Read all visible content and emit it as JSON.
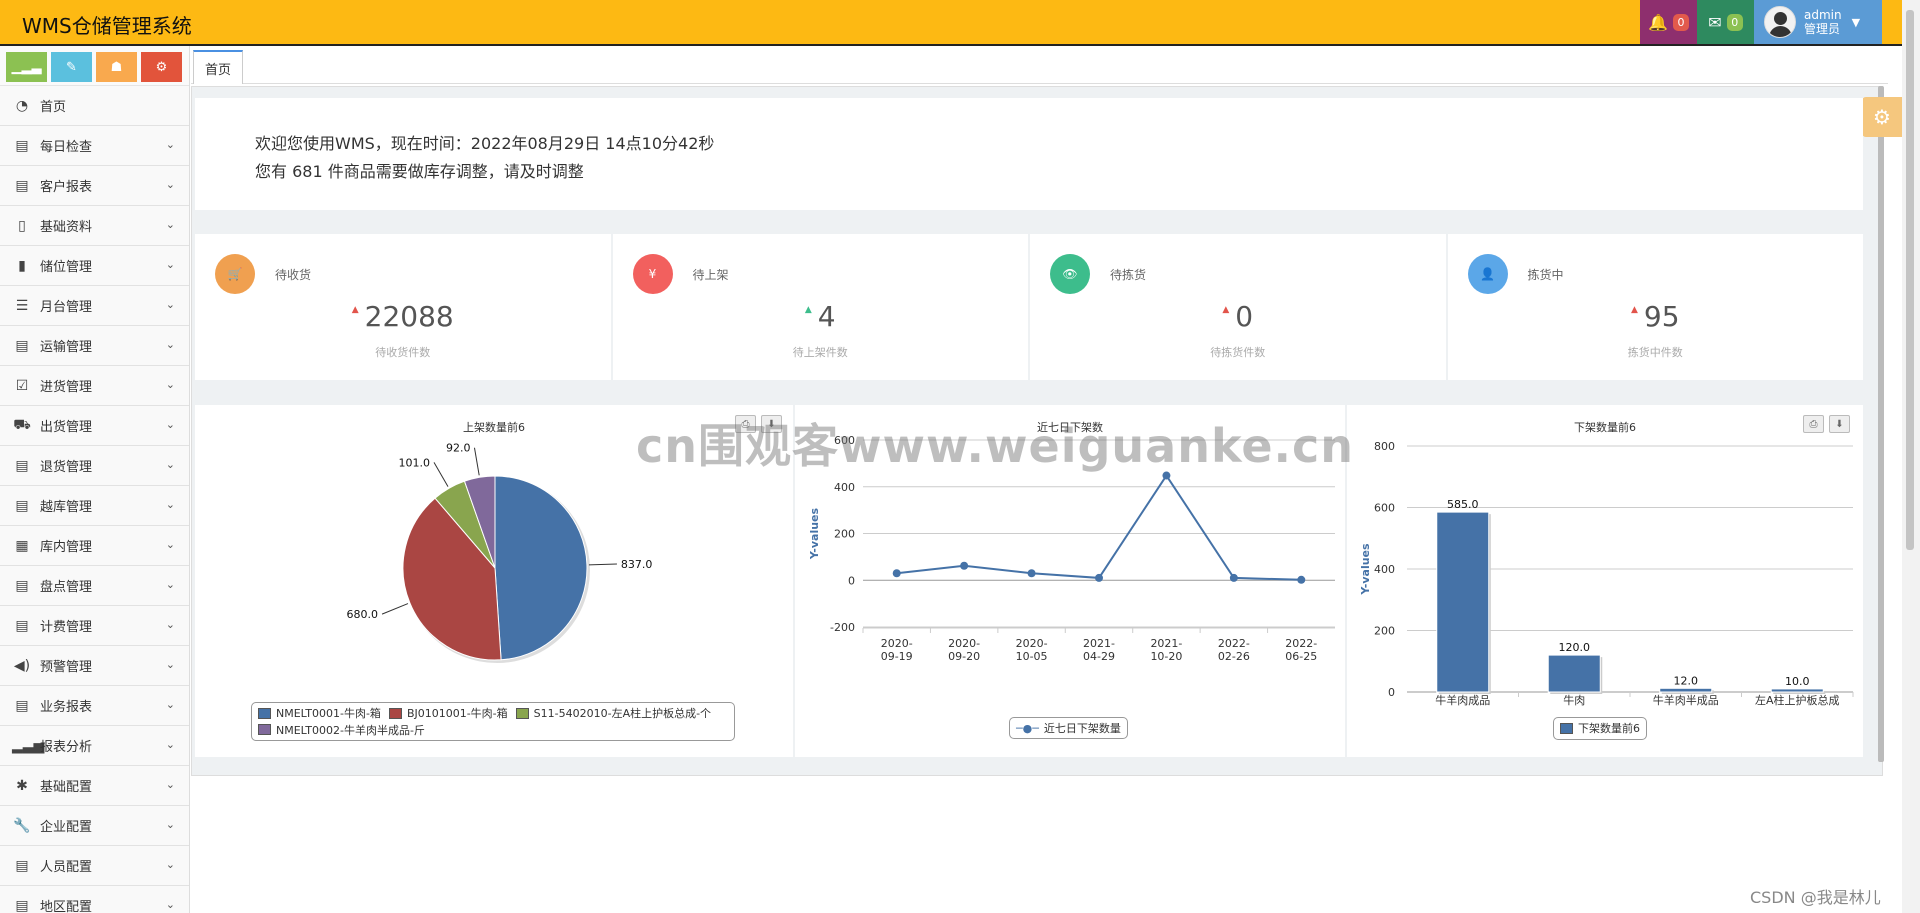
{
  "header": {
    "title": "WMS仓储管理系统",
    "notifications_count": "0",
    "messages_count": "0",
    "user_name": "admin",
    "user_role": "管理员"
  },
  "sidebar": {
    "shortcut_colors": [
      "#8cc152",
      "#5bc0de",
      "#f9a94e",
      "#e2543b"
    ],
    "items": [
      {
        "label": "首页",
        "icon": "dashboard-icon"
      },
      {
        "label": "每日检查",
        "icon": "list-icon"
      },
      {
        "label": "客户报表",
        "icon": "list-icon"
      },
      {
        "label": "基础资料",
        "icon": "file-icon"
      },
      {
        "label": "储位管理",
        "icon": "tablet-icon"
      },
      {
        "label": "月台管理",
        "icon": "th-list-icon"
      },
      {
        "label": "运输管理",
        "icon": "list-icon"
      },
      {
        "label": "进货管理",
        "icon": "check-square-icon"
      },
      {
        "label": "出货管理",
        "icon": "truck-icon"
      },
      {
        "label": "退货管理",
        "icon": "list-icon"
      },
      {
        "label": "越库管理",
        "icon": "list-icon"
      },
      {
        "label": "库内管理",
        "icon": "film-icon"
      },
      {
        "label": "盘点管理",
        "icon": "list-icon"
      },
      {
        "label": "计费管理",
        "icon": "list-icon"
      },
      {
        "label": "预警管理",
        "icon": "volume-icon"
      },
      {
        "label": "业务报表",
        "icon": "list-icon"
      },
      {
        "label": "报表分析",
        "icon": "signal-icon"
      },
      {
        "label": "基础配置",
        "icon": "asterisk-icon"
      },
      {
        "label": "企业配置",
        "icon": "wrench-icon"
      },
      {
        "label": "人员配置",
        "icon": "list-icon"
      },
      {
        "label": "地区配置",
        "icon": "list-icon"
      }
    ]
  },
  "tabs": [
    {
      "label": "首页"
    }
  ],
  "welcome": {
    "line1": "欢迎您使用WMS，现在时间：2022年08月29日 14点10分42秒",
    "line2": "您有 681 件商品需要做库存调整，请及时调整"
  },
  "stats": [
    {
      "label": "待收货",
      "value": "22088",
      "sub": "待收货件数",
      "color": "#f0a050",
      "arrow_color": "#e2544b",
      "icon": "cart-icon",
      "glyph": "🛒"
    },
    {
      "label": "待上架",
      "value": "4",
      "sub": "待上架件数",
      "color": "#f2605e",
      "arrow_color": "#3dbd8c",
      "icon": "yen-icon",
      "glyph": "¥"
    },
    {
      "label": "待拣货",
      "value": "0",
      "sub": "待拣货件数",
      "color": "#3dbd8c",
      "arrow_color": "#e2544b",
      "icon": "eye-icon",
      "glyph": "👁"
    },
    {
      "label": "拣货中",
      "value": "95",
      "sub": "拣货中件数",
      "color": "#5ba7e8",
      "arrow_color": "#e2544b",
      "icon": "user-icon",
      "glyph": "👤"
    }
  ],
  "chart_data": [
    {
      "type": "pie",
      "title": "上架数量前6",
      "series": [
        {
          "name": "NMELT0001-牛肉-箱",
          "value": 837.0,
          "label": "837.0",
          "color": "#4572a7"
        },
        {
          "name": "BJ0101001-牛肉-箱",
          "value": 680.0,
          "label": "680.0",
          "color": "#aa4643"
        },
        {
          "name": "S11-5402010-左A柱上护板总成-个",
          "value": 101.0,
          "label": "101.0",
          "color": "#89a54e"
        },
        {
          "name": "NMELT0002-牛羊肉半成品-斤",
          "value": 92.0,
          "label": "92.0",
          "color": "#80699b"
        }
      ],
      "legend": "bottom"
    },
    {
      "type": "line",
      "title": "近七日下架数",
      "categories": [
        "2020-09-19",
        "2020-09-20",
        "2020-10-05",
        "2021-04-29",
        "2021-10-20",
        "2022-02-26",
        "2022-06-25"
      ],
      "series": [
        {
          "name": "近七日下架数量",
          "values": [
            30,
            62,
            30,
            10,
            448,
            10,
            2
          ],
          "color": "#4572a7"
        }
      ],
      "ylabel": "Y-values",
      "ylim": [
        -200,
        600
      ],
      "yticks": [
        -200,
        0,
        200,
        400,
        600
      ],
      "grid": true,
      "legend": "bottom"
    },
    {
      "type": "bar",
      "title": "下架数量前6",
      "categories": [
        "牛羊肉成品",
        "牛肉",
        "牛羊肉半成品",
        "左A柱上护板总成"
      ],
      "series": [
        {
          "name": "下架数量前6",
          "values": [
            585.0,
            120.0,
            12.0,
            10.0
          ],
          "labels": [
            "585.0",
            "120.0",
            "12.0",
            "10.0"
          ],
          "color": "#4572a7"
        }
      ],
      "ylabel": "Y-values",
      "ylim": [
        0,
        800
      ],
      "yticks": [
        0,
        200,
        400,
        600,
        800
      ],
      "grid": true,
      "legend": "bottom"
    }
  ],
  "watermark": "cn围观客www.weiguanke.cn",
  "csdn_mark": "CSDN @我是林儿"
}
